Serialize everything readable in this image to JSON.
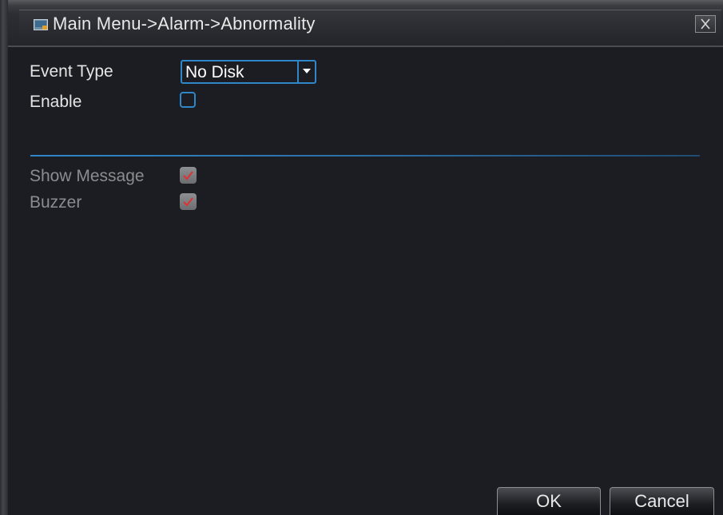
{
  "title": "Main Menu->Alarm->Abnormality",
  "fields": {
    "event_type_label": "Event Type",
    "event_type_value": "No Disk",
    "enable_label": "Enable",
    "enable_checked": false,
    "show_message_label": "Show Message",
    "show_message_checked": true,
    "buzzer_label": "Buzzer",
    "buzzer_checked": true
  },
  "buttons": {
    "ok": "OK",
    "cancel": "Cancel"
  },
  "colors": {
    "accent": "#2f86c8",
    "check": "#e03030",
    "background": "#1b1d22"
  },
  "icons": {
    "title": "window-icon",
    "close": "close-icon",
    "dropdown": "chevron-down-icon",
    "check": "check-icon"
  }
}
